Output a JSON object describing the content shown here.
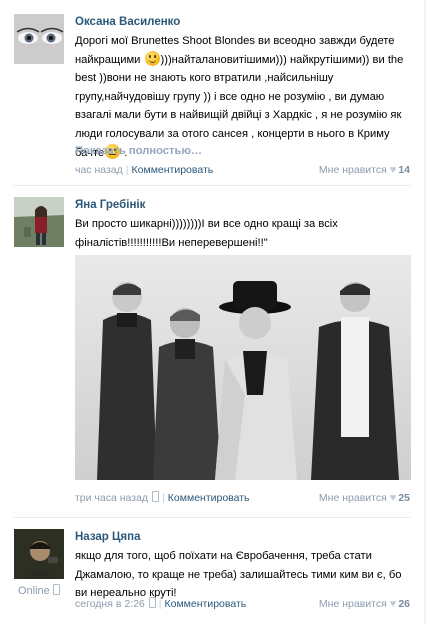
{
  "comments": [
    {
      "author": "Оксана Василенко",
      "text_parts": [
        "Дорогі мої Brunettes Shoot Blondes ви всеодно завжди будете найкращими ",
        ")))найталановитішими))) найкрутішими)) ви the best ))вони не знають кого втратили ,найсильнішу групу,найчудовішу групу )) і все одно не розумію , ви думаю взагалі мали бути в найвищій двійці з Хардкіс , я не розумію як люди голосували за отого сансея , концерти в нього в Криму бачте",
        " ."
      ],
      "emoji": [
        "smile-emoji",
        "neutral-emoji"
      ],
      "show_more": "Показать полностью…",
      "time": "час назад",
      "reply": "Комментировать",
      "like_label": "Мне нравится",
      "likes": "14"
    },
    {
      "author": "Яна Гребінік",
      "text": "Ви просто шикарні))))))))I ви все одно кращі за всіх фіналістів!!!!!!!!!!!Ви неперевершені!!\"",
      "time": "три часа назад",
      "reply": "Комментировать",
      "like_label": "Мне нравится",
      "likes": "25"
    },
    {
      "author": "Назар Цяпа",
      "text": "якщо для того, щоб поїхати на Євробачення, треба стати Джамалою, то краще не треба) залишайтесь тими ким ви є, бо ви нереально круті!",
      "online": "Online",
      "time": "сегодня в 2:26",
      "reply": "Комментировать",
      "like_label": "Мне нравится",
      "likes": "26"
    }
  ],
  "colors": {
    "link": "#2b587a",
    "meta": "#8b9cad",
    "divider": "#e7ebf0"
  }
}
